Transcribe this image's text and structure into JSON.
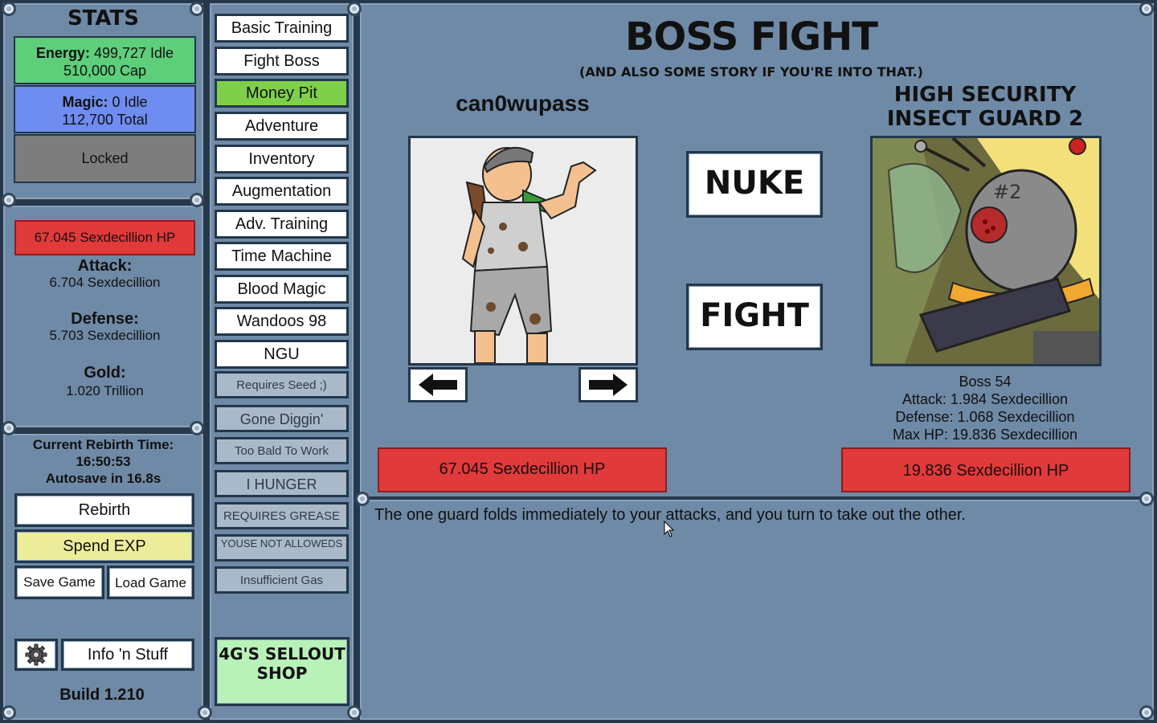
{
  "stats_panel": {
    "title": "STATS",
    "energy_label": "Energy:",
    "energy_idle": "499,727 Idle",
    "energy_cap": "510,000 Cap",
    "magic_label": "Magic:",
    "magic_idle": "0 Idle",
    "magic_total": "112,700 Total",
    "locked_label": "Locked",
    "player_hp": "67.045 Sexdecillion HP",
    "attack_label": "Attack:",
    "attack_value": "6.704 Sexdecillion",
    "defense_label": "Defense:",
    "defense_value": "5.703 Sexdecillion",
    "gold_label": "Gold:",
    "gold_value": "1.020 Trillion",
    "rebirth_time_label": "Current Rebirth Time:",
    "rebirth_time_value": "16:50:53",
    "autosave": "Autosave in 16.8s",
    "rebirth_button": "Rebirth",
    "spend_exp_button": "Spend EXP",
    "save_button": "Save Game",
    "load_button": "Load Game",
    "info_button": "Info 'n Stuff",
    "build": "Build 1.210",
    "colors": {
      "energy": "#5dce7a",
      "magic": "#6f8cf0",
      "locked": "#7d7d7d",
      "hp": "#e03a3a",
      "spend_exp": "#ecec9a"
    }
  },
  "menu": {
    "items": [
      {
        "label": "Basic Training",
        "state": "normal"
      },
      {
        "label": "Fight Boss",
        "state": "normal"
      },
      {
        "label": "Money Pit",
        "state": "active"
      },
      {
        "label": "Adventure",
        "state": "normal"
      },
      {
        "label": "Inventory",
        "state": "normal"
      },
      {
        "label": "Augmentation",
        "state": "normal"
      },
      {
        "label": "Adv. Training",
        "state": "normal"
      },
      {
        "label": "Time Machine",
        "state": "normal"
      },
      {
        "label": "Blood Magic",
        "state": "normal"
      },
      {
        "label": "Wandoos 98",
        "state": "normal"
      },
      {
        "label": "NGU",
        "state": "normal"
      },
      {
        "label": "Requires Seed ;)",
        "state": "locked"
      },
      {
        "label": "Gone Diggin'",
        "state": "locked"
      },
      {
        "label": "Too Bald To Work",
        "state": "locked"
      },
      {
        "label": "I HUNGER",
        "state": "locked"
      },
      {
        "label": "REQUIRES GREASE",
        "state": "locked"
      },
      {
        "label": "YOUSE NOT ALLOWEDS",
        "state": "locked"
      },
      {
        "label": "Insufficient Gas",
        "state": "locked"
      }
    ],
    "shop_label": "4G'S SELLOUT SHOP",
    "active_color": "#7ed04a",
    "shop_color": "#b8f2b8"
  },
  "boss_fight": {
    "title": "BOSS FIGHT",
    "subtitle": "(AND ALSO SOME STORY IF YOU'RE INTO THAT.)",
    "player_name": "can0wupass",
    "boss_name": "HIGH SECURITY INSECT GUARD 2",
    "nuke_button": "NUKE",
    "fight_button": "FIGHT",
    "boss_number": "Boss 54",
    "boss_attack": "Attack: 1.984 Sexdecillion",
    "boss_defense": "Defense: 1.068 Sexdecillion",
    "boss_max_hp": "Max HP: 19.836 Sexdecillion",
    "player_hp_bar": "67.045 Sexdecillion HP",
    "boss_hp_bar": "19.836 Sexdecillion HP",
    "player_hp_fraction": 1.0,
    "boss_hp_fraction": 1.0,
    "story_text": "The one guard folds immediately to your attacks, and you turn to take out the other.",
    "boss_badge": "#2"
  }
}
